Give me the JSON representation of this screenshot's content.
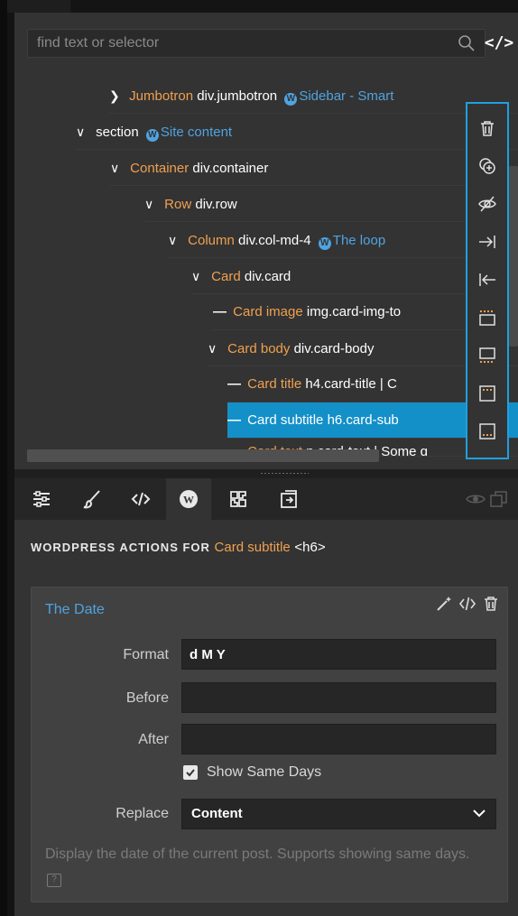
{
  "search": {
    "placeholder": "find text or selector",
    "value": ""
  },
  "code_toggle_label": "</>",
  "tree": [
    {
      "chevron": "❯",
      "name": "Jumbotron",
      "element": "div.jumbotron",
      "wp": "Sidebar - Smart"
    },
    {
      "chevron": "∨",
      "name": "",
      "element": "section",
      "wp": "Site content"
    },
    {
      "chevron": "∨",
      "name": "Container",
      "element": "div.container",
      "wp": ""
    },
    {
      "chevron": "∨",
      "name": "Row",
      "element": "div.row",
      "wp": ""
    },
    {
      "chevron": "∨",
      "name": "Column",
      "element": "div.col-md-4",
      "wp": "The loop"
    },
    {
      "chevron": "∨",
      "name": "Card",
      "element": "div.card",
      "wp": ""
    },
    {
      "chevron": "—",
      "name": "Card image",
      "element": "img.card-img-to",
      "wp": ""
    },
    {
      "chevron": "∨",
      "name": "Card body",
      "element": "div.card-body",
      "wp": ""
    },
    {
      "chevron": "—",
      "name": "Card title",
      "element": "h4.card-title | C",
      "wp": ""
    },
    {
      "chevron": "—",
      "name": "Card subtitle",
      "element": "h6.card-sub",
      "wp": ""
    },
    {
      "chevron": "—",
      "name": "Card text",
      "element": "p.card-text | Some q",
      "wp": ""
    }
  ],
  "float_tools": [
    "trash-icon",
    "duplicate-icon",
    "hide-icon",
    "indent-icon",
    "outdent-icon",
    "insert-before-icon",
    "insert-after-icon",
    "insert-top-icon",
    "insert-bottom-icon"
  ],
  "tabs": [
    "properties-icon",
    "style-icon",
    "code-icon",
    "wordpress-icon",
    "components-icon",
    "export-icon"
  ],
  "actions": {
    "heading": "WORDPRESS ACTIONS FOR",
    "element_name": "Card subtitle",
    "element_tag": "<h6>"
  },
  "action_card": {
    "title": "The Date",
    "fields": {
      "format_label": "Format",
      "format_value": "d M Y",
      "before_label": "Before",
      "before_value": "",
      "after_label": "After",
      "after_value": "",
      "show_same_days_label": "Show Same Days",
      "show_same_days_checked": true,
      "replace_label": "Replace",
      "replace_value": "Content"
    },
    "help_text": "Display the date of the current post. Supports showing same days."
  },
  "colors": {
    "accent": "#1fa0e0",
    "wordpress_blue": "#4fa3e0",
    "element_name_orange": "#f0a050",
    "selected_row": "#1490c8"
  }
}
